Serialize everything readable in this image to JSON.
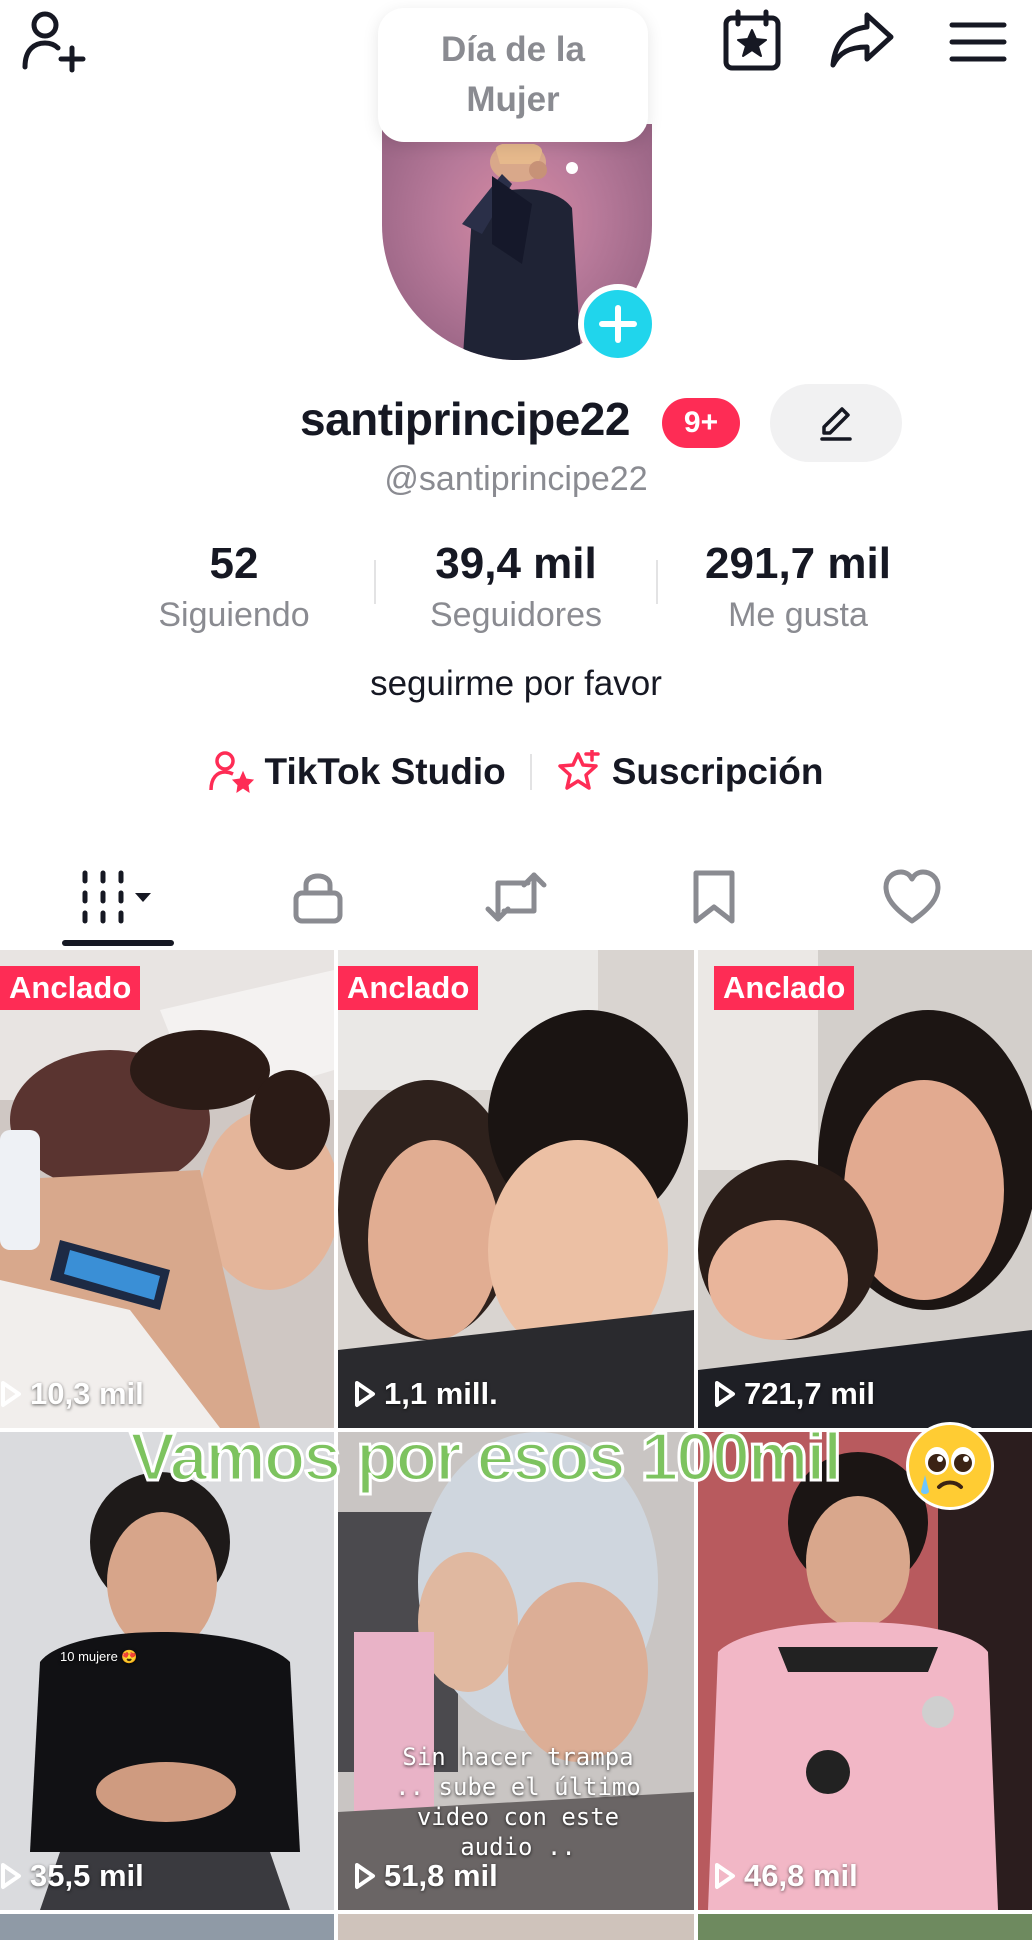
{
  "header": {
    "add_friend_icon": "add-user-icon",
    "bubble_text": "Día de la Mujer",
    "calendar_icon": "calendar-star-icon",
    "share_icon": "share-icon",
    "menu_icon": "hamburger-icon"
  },
  "profile": {
    "username": "santiprincipe22",
    "notification_badge": "9+",
    "handle": "@santiprincipe22",
    "bio": "seguirme por favor"
  },
  "stats": [
    {
      "value": "52",
      "label": "Siguiendo"
    },
    {
      "value": "39,4 mil",
      "label": "Seguidores"
    },
    {
      "value": "291,7 mil",
      "label": "Me gusta"
    }
  ],
  "links": {
    "studio": "TikTok Studio",
    "subscription": "Suscripción"
  },
  "tabs": [
    {
      "name": "videos-grid",
      "icon": "grid-icon",
      "active": true
    },
    {
      "name": "private",
      "icon": "lock-icon"
    },
    {
      "name": "reposts",
      "icon": "repost-icon"
    },
    {
      "name": "favorites",
      "icon": "bookmark-icon"
    },
    {
      "name": "liked",
      "icon": "heart-icon"
    }
  ],
  "videos": [
    {
      "pinned": "Anclado",
      "views": "10,3 mil"
    },
    {
      "pinned": "Anclado",
      "views": "1,1 mill."
    },
    {
      "pinned": "Anclado",
      "views": "721,7 mil"
    },
    {
      "views": "35,5 mil",
      "caption": "10 mujere 😍"
    },
    {
      "views": "51,8 mil",
      "caption": "Sin hacer trampa .. sube el último video con este audio .."
    },
    {
      "views": "46,8 mil"
    }
  ],
  "overlay_text": "Vamos por esos 100mil",
  "colors": {
    "accent": "#fe2c55",
    "cyan": "#20d5ec",
    "overlay_green": "#7dc35f",
    "muted_text": "#8a8b91"
  }
}
